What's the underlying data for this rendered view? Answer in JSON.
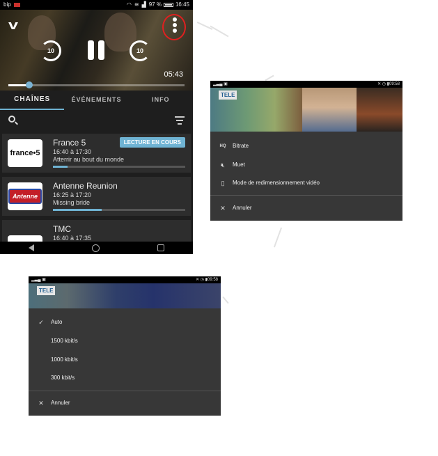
{
  "main_screen": {
    "status": {
      "carrier": "bip",
      "battery": "97 %",
      "time": "16:45"
    },
    "player": {
      "skip_back": "10",
      "skip_forward": "10",
      "elapsed": "05:43",
      "progress": 0.12
    },
    "tabs": [
      {
        "label": "CHAÎNES",
        "active": true
      },
      {
        "label": "ÉVÉNEMENTS",
        "active": false
      },
      {
        "label": "INFO",
        "active": false
      }
    ],
    "channels": [
      {
        "logo": "france•5",
        "name": "France 5",
        "time": "16:40 à 17:30",
        "program": "Atterrir au bout du monde",
        "progress": 0.11,
        "badge": "LECTURE EN COURS"
      },
      {
        "logo": "Antenne",
        "name": "Antenne Reunion",
        "time": "16:25 à 17:20",
        "program": "Missing bride",
        "progress": 0.37
      },
      {
        "logo": "TMC",
        "name": "TMC",
        "time": "16:40 à 17:35",
        "program": ""
      }
    ]
  },
  "options_screen": {
    "status": {
      "time": "09:58"
    },
    "channel_logo": "TELE",
    "items": [
      {
        "icon": "HQ",
        "label": "Bitrate"
      },
      {
        "icon": "mute",
        "label": "Muet"
      },
      {
        "icon": "phone",
        "label": "Mode de redimensionnement vidéo"
      }
    ],
    "cancel": "Annuler"
  },
  "bitrate_screen": {
    "status": {
      "time": "09:58"
    },
    "channel_logo": "TELE",
    "options": [
      {
        "label": "Auto",
        "selected": true
      },
      {
        "label": "1500 kbit/s",
        "selected": false
      },
      {
        "label": "1000 kbit/s",
        "selected": false
      },
      {
        "label": "300 kbit/s",
        "selected": false
      }
    ],
    "cancel": "Annuler"
  },
  "colors": {
    "accent": "#6fb3d3",
    "highlight_ring": "#e02020",
    "background": "#1e1e1e",
    "menu": "#373737"
  }
}
